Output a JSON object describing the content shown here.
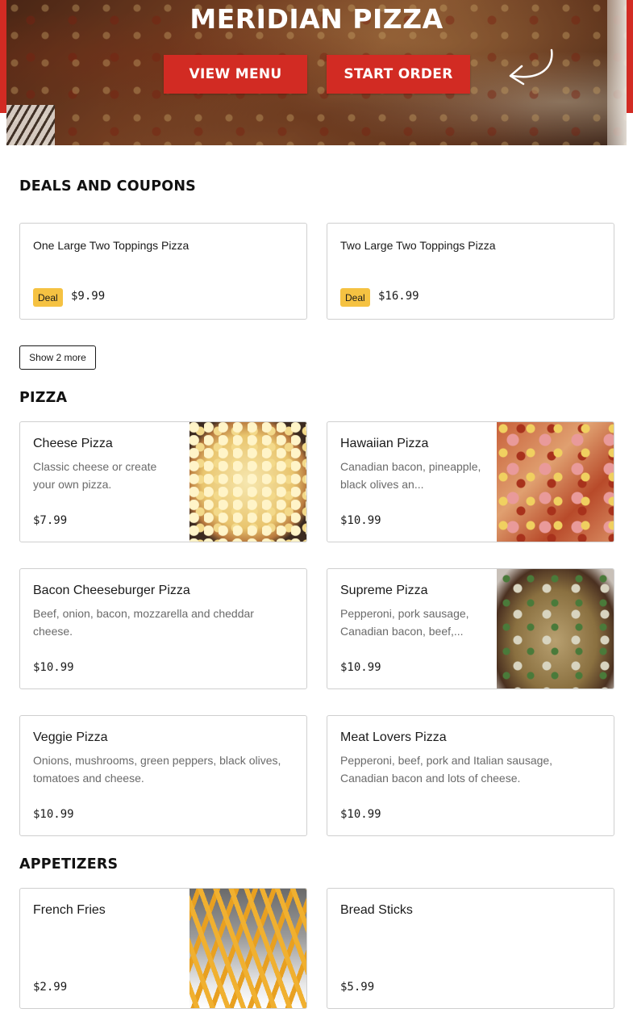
{
  "hero": {
    "title": "MERIDIAN PIZZA",
    "view_menu_label": "VIEW MENU",
    "start_order_label": "START ORDER"
  },
  "deals": {
    "title": "DEALS AND COUPONS",
    "items": [
      {
        "name": "One Large Two Toppings Pizza",
        "badge": "Deal",
        "price": "$9.99"
      },
      {
        "name": "Two Large Two Toppings Pizza",
        "badge": "Deal",
        "price": "$16.99"
      }
    ],
    "show_more_label": "Show 2 more"
  },
  "pizza": {
    "title": "PIZZA",
    "items": [
      {
        "name": "Cheese Pizza",
        "description": "Classic cheese or create your own pizza.",
        "price": "$7.99"
      },
      {
        "name": "Hawaiian Pizza",
        "description": "Canadian bacon, pineapple, black olives an...",
        "price": "$10.99"
      },
      {
        "name": "Bacon Cheeseburger Pizza",
        "description": "Beef, onion, bacon, mozzarella and cheddar cheese.",
        "price": "$10.99"
      },
      {
        "name": "Supreme Pizza",
        "description": "Pepperoni, pork sausage, Canadian bacon, beef,...",
        "price": "$10.99"
      },
      {
        "name": "Veggie Pizza",
        "description": "Onions, mushrooms, green peppers, black olives, tomatoes and cheese.",
        "price": "$10.99"
      },
      {
        "name": "Meat Lovers Pizza",
        "description": "Pepperoni, beef, pork and Italian sausage, Canadian bacon and lots of cheese.",
        "price": "$10.99"
      }
    ]
  },
  "appetizers": {
    "title": "APPETIZERS",
    "items": [
      {
        "name": "French Fries",
        "price": "$2.99"
      },
      {
        "name": "Bread Sticks",
        "price": "$5.99"
      }
    ]
  },
  "colors": {
    "brand_red": "#d22b23",
    "deal_badge": "#f5c242"
  }
}
